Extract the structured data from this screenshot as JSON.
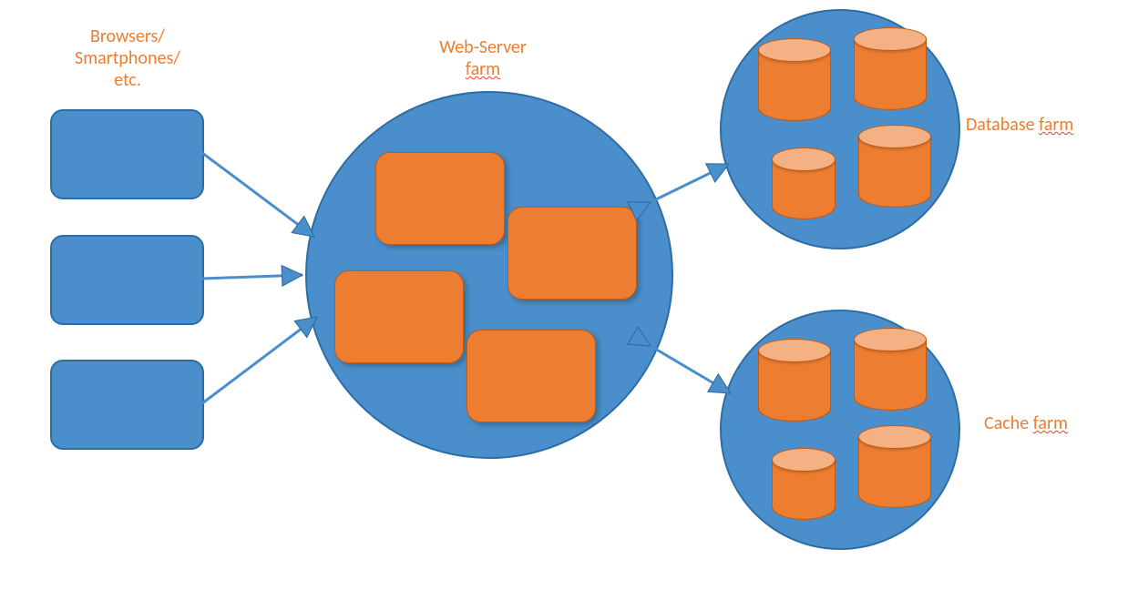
{
  "labels": {
    "clients_line1": "Browsers/",
    "clients_line2": "Smartphones/",
    "clients_line3": "etc.",
    "webserver_line1": "Web-Server",
    "webserver_line2_word": "farm",
    "database_prefix": "Database ",
    "database_word": "farm",
    "cache_prefix": "Cache ",
    "cache_word": "farm"
  },
  "diagram": {
    "client_boxes_count": 3,
    "web_server_nodes": 4,
    "database_cylinders": 4,
    "cache_cylinders": 4,
    "arrows": {
      "client_to_web": 3,
      "web_to_db_bidirectional": true,
      "web_to_cache_bidirectional": true
    }
  },
  "colors": {
    "label": "#ED7D31",
    "blue_fill": "#4A8FCB",
    "blue_stroke": "#2E6DA4",
    "orange_fill": "#ED7D31",
    "orange_top": "#F4B183",
    "orange_stroke": "#C55A11"
  }
}
